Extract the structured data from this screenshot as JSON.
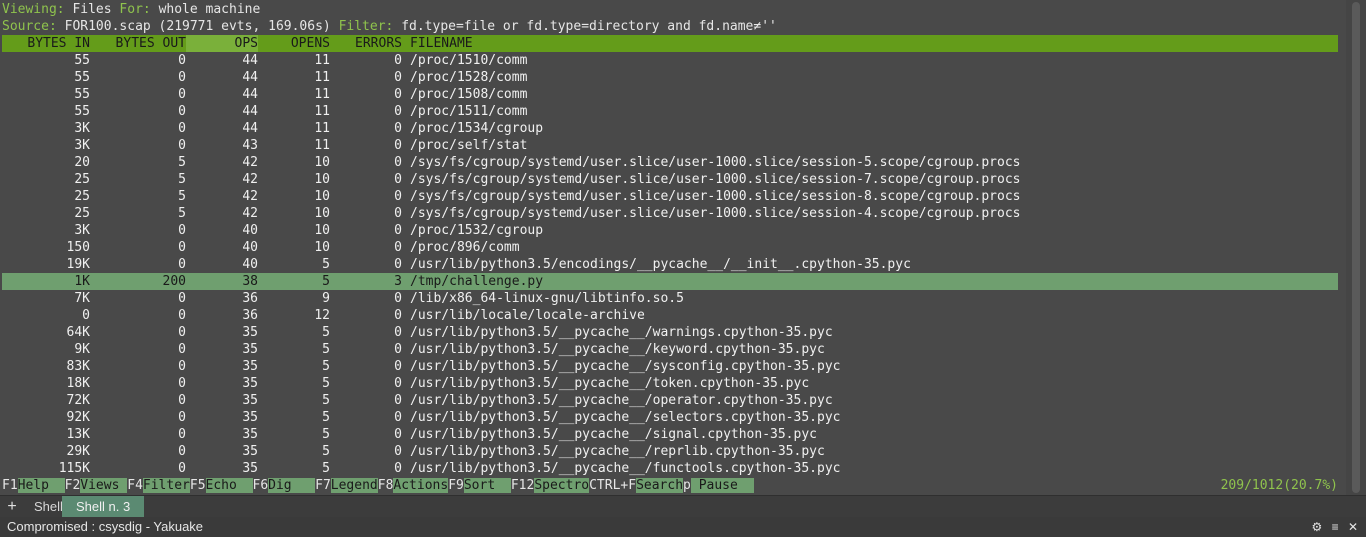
{
  "header": {
    "viewing_label": "Viewing:",
    "viewing_value": "Files",
    "for_label": "For:",
    "for_value": "whole machine",
    "source_label": "Source:",
    "source_value": "FOR100.scap (219771 evts, 169.06s)",
    "filter_label": "Filter:",
    "filter_value": "fd.type=file or fd.type=directory and fd.name≠''"
  },
  "columns": {
    "bytes_in": "BYTES IN",
    "bytes_out": "BYTES OUT",
    "ops": "OPS",
    "opens": "OPENS",
    "errors": "ERRORS",
    "filename": "FILENAME"
  },
  "rows": [
    {
      "in": "55",
      "out": "0",
      "ops": "44",
      "opens": "11",
      "err": "0",
      "file": "/proc/1510/comm"
    },
    {
      "in": "55",
      "out": "0",
      "ops": "44",
      "opens": "11",
      "err": "0",
      "file": "/proc/1528/comm"
    },
    {
      "in": "55",
      "out": "0",
      "ops": "44",
      "opens": "11",
      "err": "0",
      "file": "/proc/1508/comm"
    },
    {
      "in": "55",
      "out": "0",
      "ops": "44",
      "opens": "11",
      "err": "0",
      "file": "/proc/1511/comm"
    },
    {
      "in": "3K",
      "out": "0",
      "ops": "44",
      "opens": "11",
      "err": "0",
      "file": "/proc/1534/cgroup"
    },
    {
      "in": "3K",
      "out": "0",
      "ops": "43",
      "opens": "11",
      "err": "0",
      "file": "/proc/self/stat"
    },
    {
      "in": "20",
      "out": "5",
      "ops": "42",
      "opens": "10",
      "err": "0",
      "file": "/sys/fs/cgroup/systemd/user.slice/user-1000.slice/session-5.scope/cgroup.procs"
    },
    {
      "in": "25",
      "out": "5",
      "ops": "42",
      "opens": "10",
      "err": "0",
      "file": "/sys/fs/cgroup/systemd/user.slice/user-1000.slice/session-7.scope/cgroup.procs"
    },
    {
      "in": "25",
      "out": "5",
      "ops": "42",
      "opens": "10",
      "err": "0",
      "file": "/sys/fs/cgroup/systemd/user.slice/user-1000.slice/session-8.scope/cgroup.procs"
    },
    {
      "in": "25",
      "out": "5",
      "ops": "42",
      "opens": "10",
      "err": "0",
      "file": "/sys/fs/cgroup/systemd/user.slice/user-1000.slice/session-4.scope/cgroup.procs"
    },
    {
      "in": "3K",
      "out": "0",
      "ops": "40",
      "opens": "10",
      "err": "0",
      "file": "/proc/1532/cgroup"
    },
    {
      "in": "150",
      "out": "0",
      "ops": "40",
      "opens": "10",
      "err": "0",
      "file": "/proc/896/comm"
    },
    {
      "in": "19K",
      "out": "0",
      "ops": "40",
      "opens": "5",
      "err": "0",
      "file": "/usr/lib/python3.5/encodings/__pycache__/__init__.cpython-35.pyc"
    },
    {
      "in": "1K",
      "out": "200",
      "ops": "38",
      "opens": "5",
      "err": "3",
      "file": "/tmp/challenge.py"
    },
    {
      "in": "7K",
      "out": "0",
      "ops": "36",
      "opens": "9",
      "err": "0",
      "file": "/lib/x86_64-linux-gnu/libtinfo.so.5"
    },
    {
      "in": "0",
      "out": "0",
      "ops": "36",
      "opens": "12",
      "err": "0",
      "file": "/usr/lib/locale/locale-archive"
    },
    {
      "in": "64K",
      "out": "0",
      "ops": "35",
      "opens": "5",
      "err": "0",
      "file": "/usr/lib/python3.5/__pycache__/warnings.cpython-35.pyc"
    },
    {
      "in": "9K",
      "out": "0",
      "ops": "35",
      "opens": "5",
      "err": "0",
      "file": "/usr/lib/python3.5/__pycache__/keyword.cpython-35.pyc"
    },
    {
      "in": "83K",
      "out": "0",
      "ops": "35",
      "opens": "5",
      "err": "0",
      "file": "/usr/lib/python3.5/__pycache__/sysconfig.cpython-35.pyc"
    },
    {
      "in": "18K",
      "out": "0",
      "ops": "35",
      "opens": "5",
      "err": "0",
      "file": "/usr/lib/python3.5/__pycache__/token.cpython-35.pyc"
    },
    {
      "in": "72K",
      "out": "0",
      "ops": "35",
      "opens": "5",
      "err": "0",
      "file": "/usr/lib/python3.5/__pycache__/operator.cpython-35.pyc"
    },
    {
      "in": "92K",
      "out": "0",
      "ops": "35",
      "opens": "5",
      "err": "0",
      "file": "/usr/lib/python3.5/__pycache__/selectors.cpython-35.pyc"
    },
    {
      "in": "13K",
      "out": "0",
      "ops": "35",
      "opens": "5",
      "err": "0",
      "file": "/usr/lib/python3.5/__pycache__/signal.cpython-35.pyc"
    },
    {
      "in": "29K",
      "out": "0",
      "ops": "35",
      "opens": "5",
      "err": "0",
      "file": "/usr/lib/python3.5/__pycache__/reprlib.cpython-35.pyc"
    },
    {
      "in": "115K",
      "out": "0",
      "ops": "35",
      "opens": "5",
      "err": "0",
      "file": "/usr/lib/python3.5/__pycache__/functools.cpython-35.pyc"
    }
  ],
  "selected_row_index": 13,
  "fkeys": [
    {
      "key": "F1",
      "label": "Help  "
    },
    {
      "key": "F2",
      "label": "Views "
    },
    {
      "key": "F4",
      "label": "Filter"
    },
    {
      "key": "F5",
      "label": "Echo  "
    },
    {
      "key": "F6",
      "label": "Dig   "
    },
    {
      "key": "F7",
      "label": "Legend"
    },
    {
      "key": "F8",
      "label": "Actions"
    },
    {
      "key": "F9",
      "label": "Sort  "
    },
    {
      "key": "F12",
      "label": "Spectro"
    },
    {
      "key": "CTRL+F",
      "label": "Search"
    },
    {
      "key": "p",
      "label": " Pause  "
    }
  ],
  "status_position": "209/1012(20.7%)",
  "tabs": [
    {
      "label": "Shell"
    },
    {
      "label": "Shell n. 3"
    }
  ],
  "window_title": "Compromised : csysdig - Yakuake",
  "colors": {
    "header_green": "#649c1a",
    "selected_row": "#6f9f6f",
    "label_green": "#8fc34d",
    "background": "#494949"
  }
}
